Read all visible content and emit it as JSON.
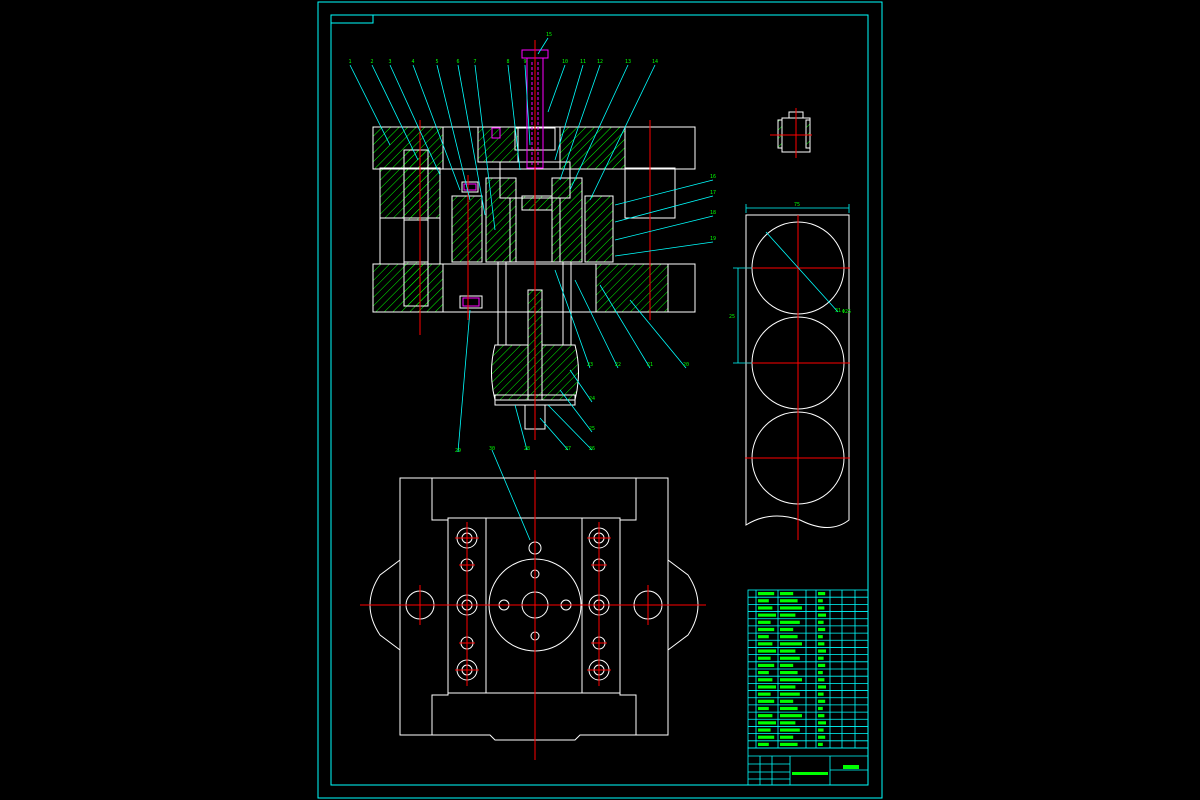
{
  "drawing": {
    "colors": {
      "background": "#000000",
      "frame": "#00ffff",
      "outline": "#ffffff",
      "center_line": "#ff0000",
      "hatch": "#00ff00",
      "leader": "#00ffff",
      "part_highlight": "#ff00ff",
      "text": "#00ff00"
    },
    "section_view": {
      "part_numbers": [
        "1",
        "2",
        "3",
        "4",
        "5",
        "6",
        "7",
        "8",
        "9",
        "10",
        "11",
        "12",
        "13",
        "14",
        "15",
        "16",
        "17",
        "18",
        "19",
        "20",
        "21",
        "22",
        "23",
        "24",
        "25",
        "26",
        "27",
        "28",
        "29",
        "30",
        "31"
      ]
    },
    "workpiece_view": {
      "dimensions": [
        "75",
        "25",
        "Φ25"
      ]
    },
    "parts_list": {
      "rows": 22,
      "columns": 8
    },
    "title_block": {
      "drawing_name": "",
      "drawing_number": ""
    }
  }
}
